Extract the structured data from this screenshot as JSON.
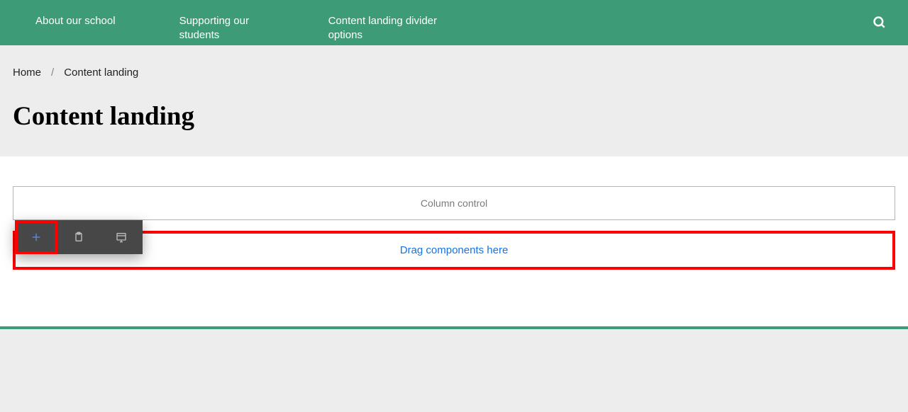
{
  "navbar": {
    "items": [
      {
        "label": "About our school"
      },
      {
        "label": "Supporting our students"
      },
      {
        "label": "Content landing divider options"
      }
    ]
  },
  "breadcrumb": {
    "home": "Home",
    "separator": "/",
    "current": "Content landing"
  },
  "page": {
    "title": "Content landing"
  },
  "editor": {
    "column_control_label": "Column control",
    "drop_zone_label": "Drag components here"
  }
}
